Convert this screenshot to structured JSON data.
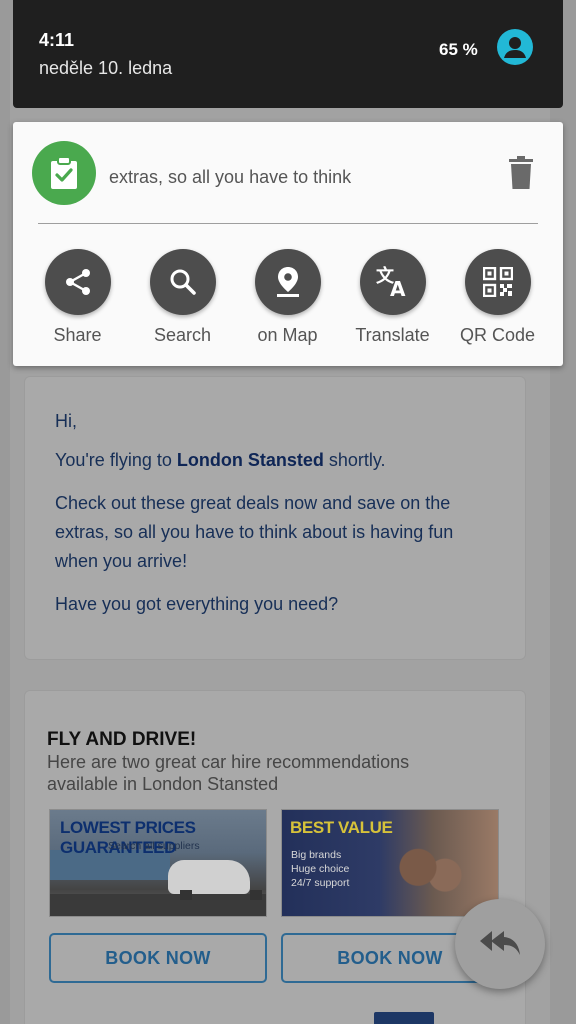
{
  "status_bar": {
    "time": "4:11",
    "date": "neděle 10. ledna",
    "battery": "65 %"
  },
  "clipboard_panel": {
    "clip_text": "extras, so all you have to think",
    "actions": [
      {
        "label": "Share",
        "icon": "share-icon"
      },
      {
        "label": "Search",
        "icon": "search-icon"
      },
      {
        "label": "on Map",
        "icon": "map-pin-icon"
      },
      {
        "label": "Translate",
        "icon": "translate-icon"
      },
      {
        "label": "QR Code",
        "icon": "qr-code-icon"
      }
    ],
    "colors": {
      "badge": "#4aa94e",
      "action_circle": "#4d4d4d"
    }
  },
  "email": {
    "greeting": "Hi,",
    "flying_prefix": "You're flying to ",
    "flying_destination": "London Stansted",
    "flying_suffix": " shortly.",
    "deals": "Check out these great deals now and save on the extras, so all you have to think about is having fun when you arrive!",
    "question": "Have you got everything you need?",
    "promo": {
      "title": "FLY AND DRIVE!",
      "subtitle": "Here are two great car hire recommendations available in London Stansted",
      "banners": [
        {
          "headline": "LOWEST PRICES GUARANTEED",
          "sub": "Search all suppliers",
          "button": "BOOK NOW"
        },
        {
          "headline": "BEST VALUE",
          "lines": [
            "Big brands",
            "Huge choice",
            "24/7 support"
          ],
          "button": "BOOK NOW"
        }
      ]
    }
  }
}
